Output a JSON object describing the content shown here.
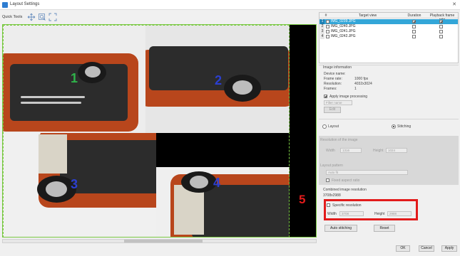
{
  "window": {
    "title": "Layout Settings"
  },
  "toolbar": {
    "label": "Quick Tools"
  },
  "canvas": {
    "frames": [
      {
        "number": "1",
        "color": "#2fb34a"
      },
      {
        "number": "2",
        "color": "#2b3fd0"
      },
      {
        "number": "3",
        "color": "#2b3fd0"
      },
      {
        "number": "4",
        "color": "#2b3fd0"
      }
    ],
    "marker": "5"
  },
  "table": {
    "headers": [
      "#",
      "Target view",
      "Duration",
      "Playback frame rate"
    ],
    "rows": [
      {
        "num": "1",
        "name": "IMG_0239.JPG",
        "selected": true,
        "duration": true,
        "playback": true
      },
      {
        "num": "2",
        "name": "IMG_0240.JPG",
        "selected": false,
        "duration": false,
        "playback": false
      },
      {
        "num": "3",
        "name": "IMG_0241.JPG",
        "selected": false,
        "duration": false,
        "playback": false
      },
      {
        "num": "4",
        "name": "IMG_0242.JPG",
        "selected": false,
        "duration": false,
        "playback": false
      }
    ]
  },
  "image_info": {
    "heading": "Image information",
    "device_label": "Device name:",
    "device_value": "",
    "framerate_label": "Frame rate:",
    "framerate_value": "1000 fps",
    "resolution_label": "Resolution:",
    "resolution_value": "4032x3024",
    "frames_label": "Frames:",
    "frames_value": "1",
    "apply_processing": "Apply image processing",
    "filter_label": "Filter name",
    "edit_button": "Edit"
  },
  "mode": {
    "layout_label": "Layout",
    "stitching_label": "Stitching"
  },
  "stitch": {
    "resolution_heading": "Resolution of the image",
    "width_label": "Width",
    "width_value": "1316",
    "height_label": "Height",
    "height_value": "1024",
    "layout_pattern_heading": "Layout pattern",
    "layout_pattern_value": "Auto fit",
    "fixed_aspect_label": "Fixed aspect ratio"
  },
  "combined": {
    "heading": "Combined image resolution",
    "current_value": "3708x2988",
    "specific_label": "Specific resolution",
    "width_label": "Width",
    "width_value": "3708",
    "height_label": "Height",
    "height_value": "2988"
  },
  "buttons": {
    "auto_stitching": "Auto stitching",
    "reset": "Reset",
    "ok": "OK",
    "cancel": "Cancel",
    "apply": "Apply"
  },
  "colors": {
    "highlight": "#e21b1b",
    "selection": "#33a6d8",
    "frame_border": "#7ac943"
  }
}
